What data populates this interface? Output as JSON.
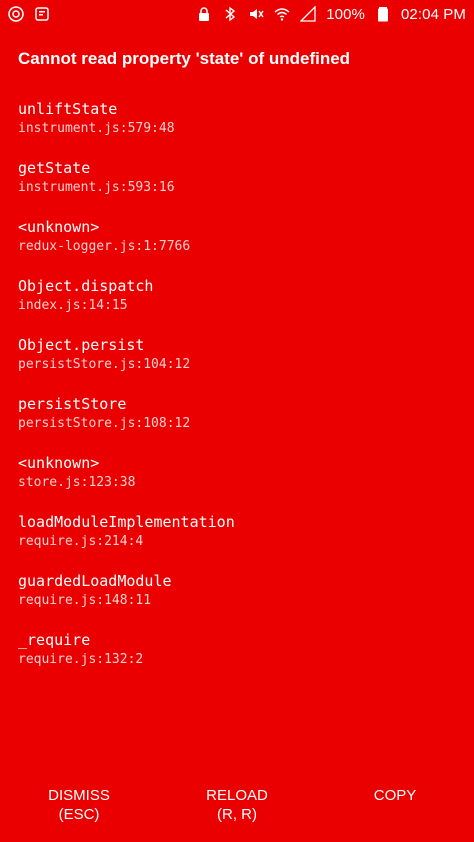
{
  "status_bar": {
    "battery": "100%",
    "time": "02:04 PM",
    "icons_left": [
      "chrome-icon",
      "notification-icon"
    ],
    "icons_right": [
      "lock-icon",
      "bluetooth-icon",
      "mute-icon",
      "wifi-icon",
      "signal-icon",
      "battery-icon"
    ]
  },
  "error": {
    "title": "Cannot read property 'state' of undefined"
  },
  "stack": [
    {
      "fn": "unliftState",
      "loc": "instrument.js:579:48"
    },
    {
      "fn": "getState",
      "loc": "instrument.js:593:16"
    },
    {
      "fn": "<unknown>",
      "loc": "redux-logger.js:1:7766"
    },
    {
      "fn": "Object.dispatch",
      "loc": "index.js:14:15"
    },
    {
      "fn": "Object.persist",
      "loc": "persistStore.js:104:12"
    },
    {
      "fn": "persistStore",
      "loc": "persistStore.js:108:12"
    },
    {
      "fn": "<unknown>",
      "loc": "store.js:123:38"
    },
    {
      "fn": "loadModuleImplementation",
      "loc": "require.js:214:4"
    },
    {
      "fn": "guardedLoadModule",
      "loc": "require.js:148:11"
    },
    {
      "fn": "_require",
      "loc": "require.js:132:2"
    }
  ],
  "buttons": {
    "dismiss": {
      "line1": "DISMISS",
      "line2": "(ESC)"
    },
    "reload": {
      "line1": "RELOAD",
      "line2": "(R, R)"
    },
    "copy": {
      "line1": "COPY",
      "line2": ""
    }
  },
  "colors": {
    "background": "#ea0000",
    "text": "#ffffff",
    "location_text": "#ffd0d0"
  }
}
